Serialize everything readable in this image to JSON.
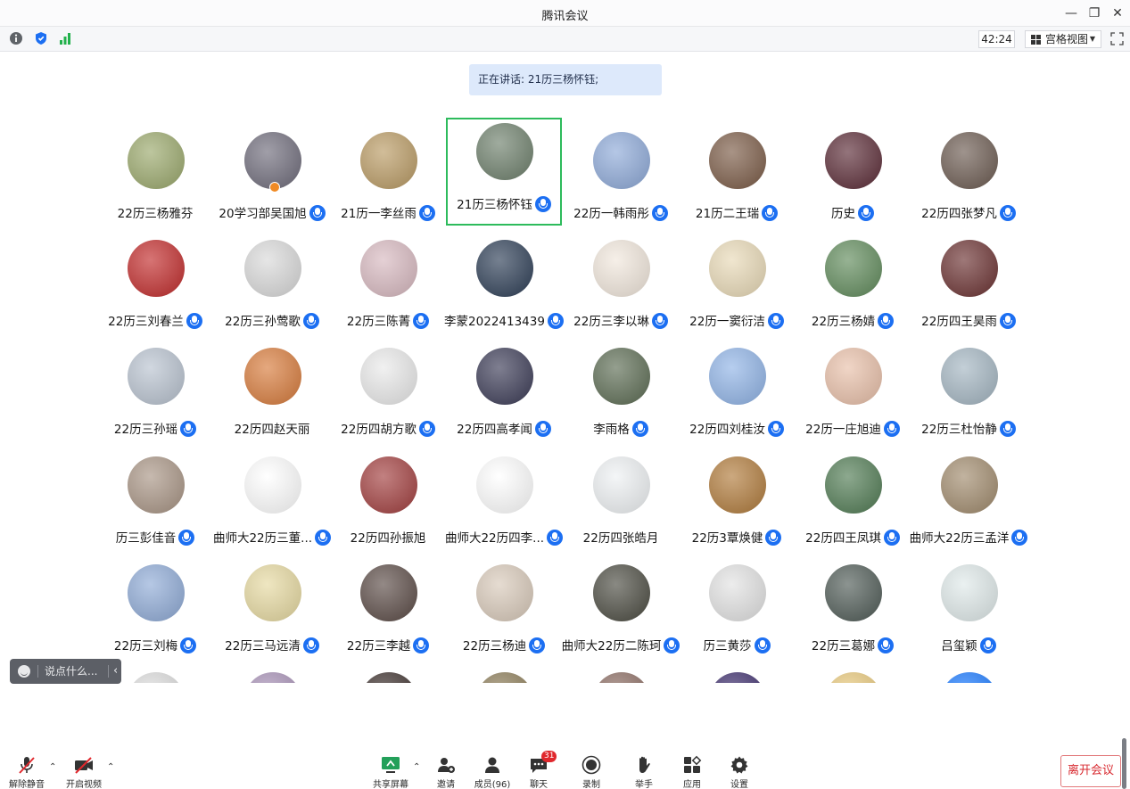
{
  "window": {
    "title": "腾讯会议"
  },
  "toolbar": {
    "timer": "42:24",
    "view_label": "宫格视图"
  },
  "speaking": {
    "text": "正在讲话: 21历三杨怀钰;"
  },
  "chat": {
    "placeholder": "说点什么..."
  },
  "participants": [
    {
      "name": "22历三杨雅芬",
      "mic": false,
      "color": "#9aa86b"
    },
    {
      "name": "20学习部吴国旭",
      "mic": true,
      "color": "#6e6b7a"
    },
    {
      "name": "21历一李丝雨",
      "mic": true,
      "color": "#b99a63"
    },
    {
      "name": "21历三杨怀钰",
      "mic": true,
      "color": "#6d7f6b"
    },
    {
      "name": "22历一韩雨彤",
      "mic": true,
      "color": "#8da9d8"
    },
    {
      "name": "21历二王瑞",
      "mic": true,
      "color": "#7a5a45"
    },
    {
      "name": "历史",
      "mic": true,
      "color": "#5a2a35"
    },
    {
      "name": "22历四张梦凡",
      "mic": true,
      "color": "#6b5a50"
    },
    {
      "name": "22历三刘春兰",
      "mic": true,
      "color": "#c12a2a"
    },
    {
      "name": "22历三孙莺歌",
      "mic": true,
      "color": "#d9d9d9"
    },
    {
      "name": "22历三陈菁",
      "mic": true,
      "color": "#d7b8bf"
    },
    {
      "name": "李蒙2022413439",
      "mic": true,
      "color": "#2c3d55"
    },
    {
      "name": "22历三李以琳",
      "mic": true,
      "color": "#f1e7dc"
    },
    {
      "name": "22历一窦衍洁",
      "mic": true,
      "color": "#e8d9b6"
    },
    {
      "name": "22历三杨婧",
      "mic": true,
      "color": "#5f8a5a"
    },
    {
      "name": "22历四王昊雨",
      "mic": true,
      "color": "#6a3030"
    },
    {
      "name": "22历三孙瑶",
      "mic": true,
      "color": "#b8c2cf"
    },
    {
      "name": "22历四赵天丽",
      "mic": false,
      "color": "#d77a3a"
    },
    {
      "name": "22历四胡方歌",
      "mic": true,
      "color": "#e9e9e9"
    },
    {
      "name": "22历四高孝闻",
      "mic": true,
      "color": "#3a3a55"
    },
    {
      "name": "李雨格",
      "mic": true,
      "color": "#5b6b52"
    },
    {
      "name": "22历四刘桂汝",
      "mic": true,
      "color": "#8fb3e6"
    },
    {
      "name": "22历一庄旭迪",
      "mic": true,
      "color": "#e8bfa8"
    },
    {
      "name": "22历三杜怡静",
      "mic": true,
      "color": "#a3b5c1"
    },
    {
      "name": "历三彭佳音",
      "mic": true,
      "color": "#a89484"
    },
    {
      "name": "曲师大22历三董...",
      "mic": true,
      "color": "#ffffff"
    },
    {
      "name": "22历四孙振旭",
      "mic": false,
      "color": "#a13d3d"
    },
    {
      "name": "曲师大22历四李...",
      "mic": true,
      "color": "#ffffff"
    },
    {
      "name": "22历四张皓月",
      "mic": false,
      "color": "#eef1f3"
    },
    {
      "name": "22历3覃焕健",
      "mic": true,
      "color": "#b07a3a"
    },
    {
      "name": "22历四王凤琪",
      "mic": true,
      "color": "#4f7a52"
    },
    {
      "name": "曲师大22历三孟洋",
      "mic": true,
      "color": "#a08a6c"
    },
    {
      "name": "22历三刘梅",
      "mic": true,
      "color": "#8eaad6"
    },
    {
      "name": "22历三马远清",
      "mic": true,
      "color": "#e6d9a0"
    },
    {
      "name": "22历三李越",
      "mic": true,
      "color": "#5a4a45"
    },
    {
      "name": "22历三杨迪",
      "mic": true,
      "color": "#d8c9b9"
    },
    {
      "name": "曲师大22历二陈珂",
      "mic": true,
      "color": "#4a4a40"
    },
    {
      "name": "历三黄莎",
      "mic": true,
      "color": "#e2e2e2"
    },
    {
      "name": "22历三葛娜",
      "mic": true,
      "color": "#4e5a55"
    },
    {
      "name": "吕玺颖",
      "mic": true,
      "color": "#dfe9e9"
    },
    {
      "name": "",
      "mic": false,
      "color": "#dcdcdc"
    },
    {
      "name": "",
      "mic": false,
      "color": "#a68fb5"
    },
    {
      "name": "",
      "mic": false,
      "color": "#3a2d2a"
    },
    {
      "name": "",
      "mic": false,
      "color": "#8a7a55"
    },
    {
      "name": "",
      "mic": false,
      "color": "#8a6a60"
    },
    {
      "name": "",
      "mic": false,
      "color": "#3a2a6a"
    },
    {
      "name": "",
      "mic": false,
      "color": "#e8c87a"
    },
    {
      "name": "",
      "mic": false,
      "color": "#1677ff"
    }
  ],
  "bottom": {
    "unmute": "解除静音",
    "video": "开启视频",
    "share": "共享屏幕",
    "invite": "邀请",
    "members": "成员(96)",
    "chat": "聊天",
    "chat_badge": "31",
    "record": "录制",
    "raise": "举手",
    "apps": "应用",
    "settings": "设置",
    "leave": "离开会议"
  }
}
